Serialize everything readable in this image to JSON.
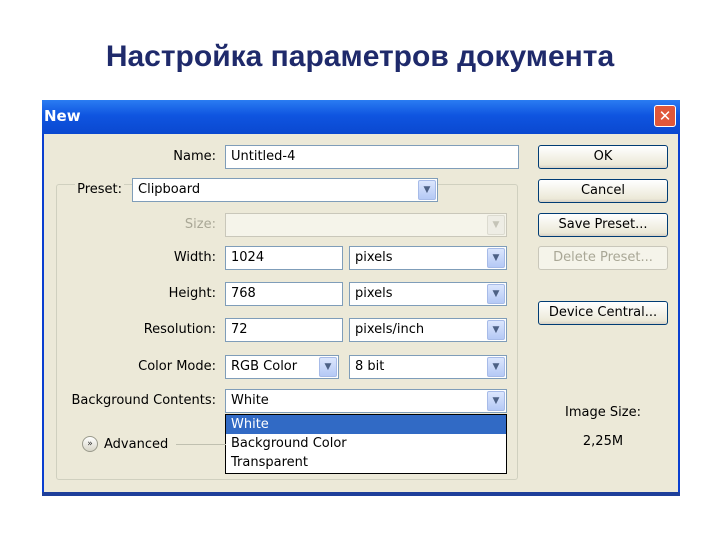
{
  "slide": {
    "title": "Настройка параметров документа"
  },
  "window": {
    "title": "New",
    "close_label": "✕"
  },
  "form": {
    "name": {
      "label": "Name:",
      "value": "Untitled-4"
    },
    "preset": {
      "label": "Preset:",
      "value": "Clipboard"
    },
    "size": {
      "label": "Size:",
      "value": ""
    },
    "width": {
      "label": "Width:",
      "value": "1024",
      "unit": "pixels"
    },
    "height": {
      "label": "Height:",
      "value": "768",
      "unit": "pixels"
    },
    "resolution": {
      "label": "Resolution:",
      "value": "72",
      "unit": "pixels/inch"
    },
    "color_mode": {
      "label": "Color Mode:",
      "value": "RGB Color",
      "depth": "8 bit"
    },
    "background": {
      "label": "Background Contents:",
      "value": "White",
      "options": [
        "White",
        "Background Color",
        "Transparent"
      ],
      "highlighted": "White"
    },
    "advanced_label": "Advanced"
  },
  "buttons": {
    "ok": "OK",
    "cancel": "Cancel",
    "save_preset": "Save Preset...",
    "delete_preset": "Delete Preset...",
    "device_central": "Device Central..."
  },
  "image_size": {
    "label": "Image Size:",
    "value": "2,25M"
  },
  "colors": {
    "titlebar": "#0a48d0",
    "selection": "#316ac5",
    "title_text": "#1f2a6b"
  }
}
